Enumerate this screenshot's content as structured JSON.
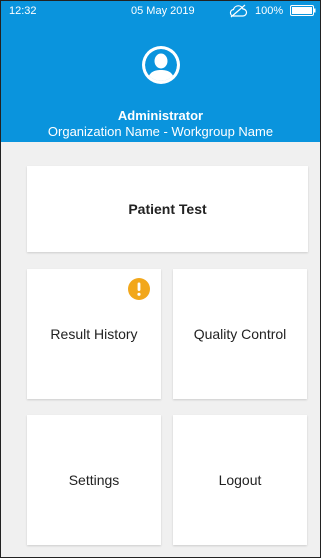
{
  "status_bar": {
    "time": "12:32",
    "date": "05 May 2019",
    "cloud_icon": "cloud-offline-icon",
    "battery_text": "100%",
    "battery_icon": "battery-icon",
    "battery_level": 1.0
  },
  "header": {
    "avatar_icon": "user-avatar-icon",
    "user_name": "Administrator",
    "org_name": "Organization Name - Workgroup Name"
  },
  "tiles": {
    "patient_test": "Patient Test",
    "result_history": "Result History",
    "result_history_alert_icon": "exclamation-alert-icon",
    "quality_control": "Quality Control",
    "settings": "Settings",
    "logout": "Logout"
  },
  "colors": {
    "header_blue": "#0a94dd",
    "background": "#f0f0f0",
    "tile": "#ffffff",
    "alert": "#f2a71b"
  }
}
